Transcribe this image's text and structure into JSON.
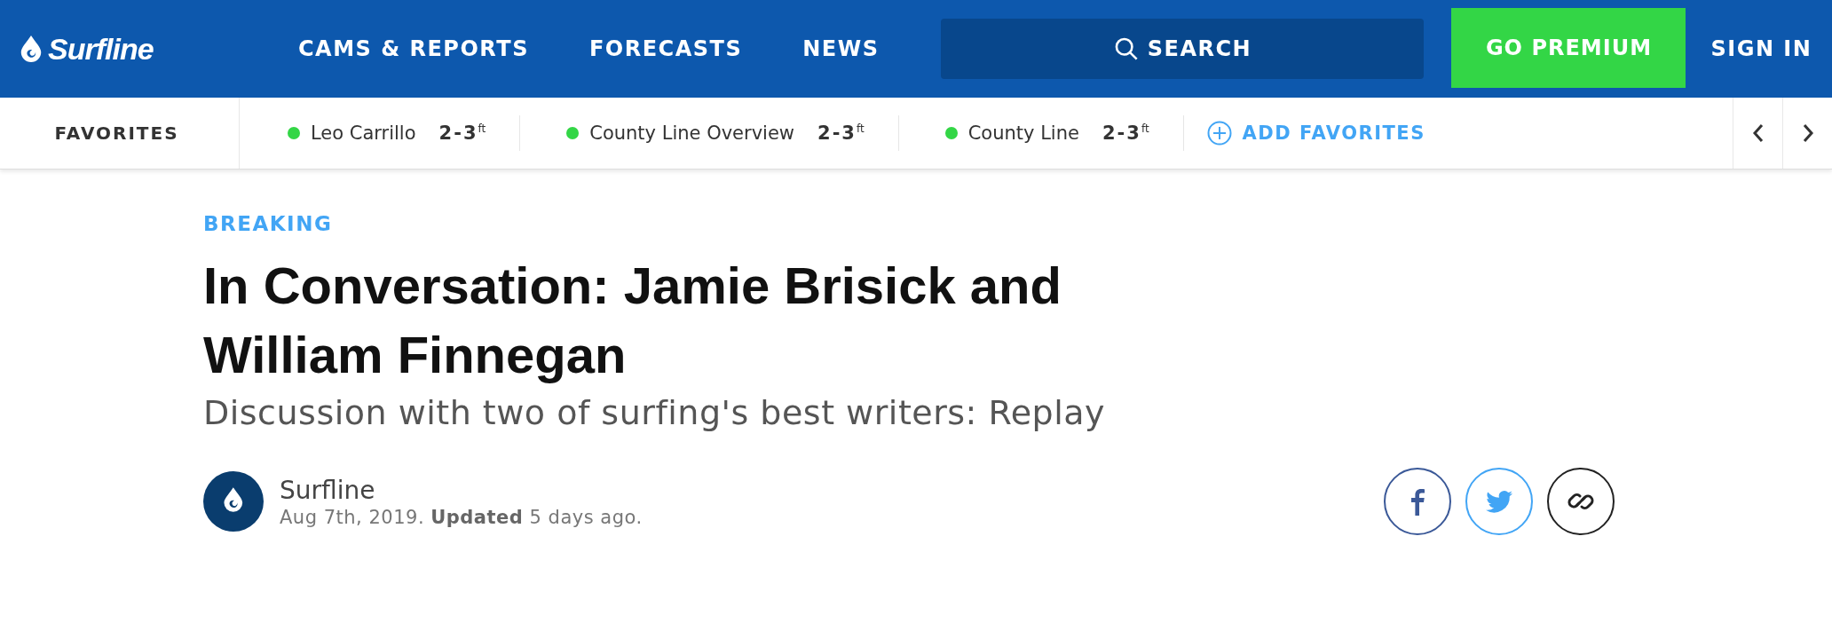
{
  "header": {
    "logo": "Surfline",
    "nav": [
      "CAMS & REPORTS",
      "FORECASTS",
      "NEWS"
    ],
    "search": "SEARCH",
    "premium": "GO PREMIUM",
    "sign_in": "SIGN IN"
  },
  "favorites": {
    "label": "FAVORITES",
    "items": [
      {
        "name": "Leo Carrillo",
        "height": "2-3",
        "unit": "ft",
        "color": "#33d646"
      },
      {
        "name": "County Line Overview",
        "height": "2-3",
        "unit": "ft",
        "color": "#33d646"
      },
      {
        "name": "County Line",
        "height": "2-3",
        "unit": "ft",
        "color": "#33d646"
      }
    ],
    "add": "ADD FAVORITES"
  },
  "article": {
    "category": "BREAKING",
    "title": "In Conversation: Jamie Brisick and William Finnegan",
    "subtitle": "Discussion with two of surfing's best writers: Replay",
    "author": "Surfline",
    "date": "Aug 7th, 2019. **Updated** 5 days ago.",
    "share": [
      {
        "kind": "facebook"
      },
      {
        "kind": "twitter"
      },
      {
        "kind": "link"
      }
    ]
  }
}
